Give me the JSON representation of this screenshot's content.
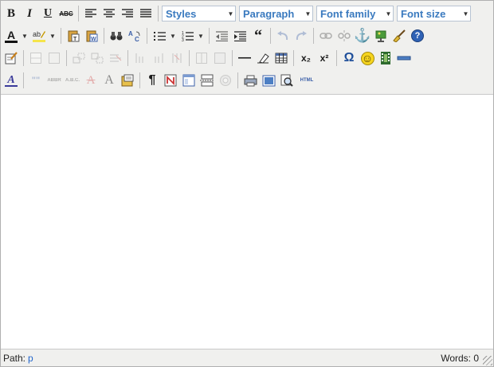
{
  "toolbar": {
    "row1": {
      "bold": "B",
      "italic": "I",
      "underline": "U",
      "strike": "ABC",
      "styles_value": "Styles",
      "format_value": "Paragraph",
      "fontfamily_value": "Font family",
      "fontsize_value": "Font size"
    },
    "row2": {
      "forecolor": "A",
      "find": "🔍",
      "blockquote": "“",
      "anchor": "⚓",
      "help": "?"
    },
    "row3": {
      "hr": "—",
      "sub": "x₂",
      "sup": "x²",
      "charmap": "Ω",
      "emotions": "☺"
    },
    "row4": {
      "styleprops": "A",
      "cite": "\"\"",
      "abbr": "ABBR",
      "acronym": "A.B.C.",
      "del": "A",
      "ins": "A",
      "visualchars": "¶",
      "code": "HTML"
    }
  },
  "status": {
    "path_label": "Path:",
    "path_value": "p",
    "words": "Words: 0"
  },
  "colors": {
    "toolbar_bg": "#f0f0ee",
    "select_text": "#3a7abf",
    "path_link": "#2266cc"
  }
}
